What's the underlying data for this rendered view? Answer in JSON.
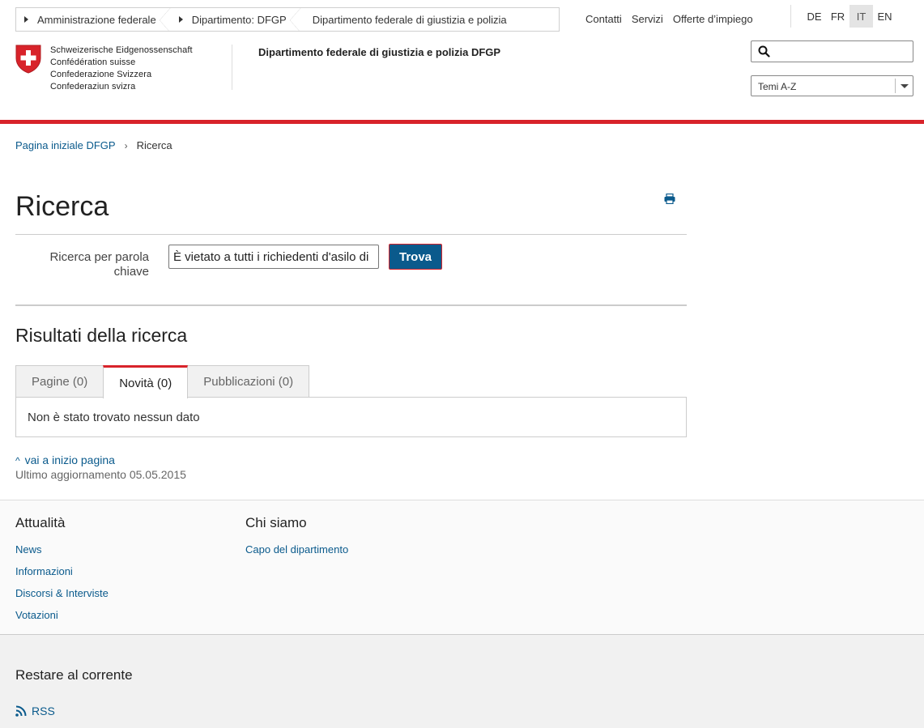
{
  "top_crumbs": [
    "Amministrazione federale",
    "Dipartimento: DFGP",
    "Dipartimento federale di giustizia e polizia"
  ],
  "top_links": [
    "Contatti",
    "Servizi",
    "Offerte d’impiego"
  ],
  "languages": [
    "DE",
    "FR",
    "IT",
    "EN"
  ],
  "active_language": "IT",
  "logo_lines": [
    "Schweizerische Eidgenossenschaft",
    "Confédération suisse",
    "Confederazione Svizzera",
    "Confederaziun svizra"
  ],
  "department_title": "Dipartimento federale di giustizia e polizia DFGP",
  "search": {
    "value": "",
    "placeholder": ""
  },
  "topics_select": "Temi A-Z",
  "breadcrumb": {
    "home": "Pagina iniziale DFGP",
    "current": "Ricerca"
  },
  "page_title": "Ricerca",
  "keyword_label": "Ricerca per parola chiave",
  "keyword_value": "È vietato a tutti i richiedenti d'asilo di",
  "find_button": "Trova",
  "results_title": "Risultati della ricerca",
  "tabs": [
    {
      "label": "Pagine (0)",
      "active": false
    },
    {
      "label": "Novità (0)",
      "active": true
    },
    {
      "label": "Pubblicazioni (0)",
      "active": false
    }
  ],
  "no_data": "Non è stato trovato nessun dato",
  "back_to_top": "vai a inizio pagina",
  "last_update": "Ultimo aggiornamento 05.05.2015",
  "footer": {
    "col1": {
      "title": "Attualità",
      "links": [
        "News",
        "Informazioni",
        "Discorsi & Interviste",
        "Votazioni"
      ]
    },
    "col2": {
      "title": "Chi siamo",
      "links": [
        "Capo del dipartimento"
      ]
    },
    "stay_updated": "Restare al corrente",
    "rss": "RSS"
  },
  "colors": {
    "accent_red": "#d8232a",
    "link_blue": "#0a5a8c"
  }
}
